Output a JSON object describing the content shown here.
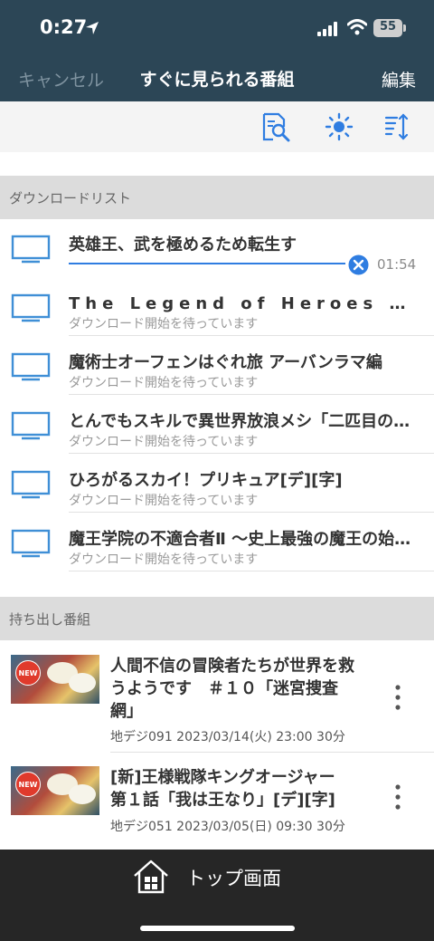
{
  "status_bar": {
    "time": "0:27",
    "battery": "55"
  },
  "nav": {
    "cancel_label": "キャンセル",
    "title": "すぐに見られる番組",
    "edit_label": "編集"
  },
  "toolbar": {
    "icons": [
      "document-search-icon",
      "brightness-icon",
      "sort-icon"
    ]
  },
  "download_section": {
    "header": "ダウンロードリスト",
    "items": [
      {
        "title": "英雄王、武を極めるため転生す",
        "status": "",
        "progress": 1.0,
        "remaining": "01:54"
      },
      {
        "title": "The Legend of Heroes 閃の軌跡 NORTHERN WAR",
        "status": "ダウンロード開始を待っています"
      },
      {
        "title": "魔術士オーフェンはぐれ旅 アーバンラマ編",
        "status": "ダウンロード開始を待っています"
      },
      {
        "title": "とんでもスキルで異世界放浪メシ「二匹目の従魔」",
        "status": "ダウンロード開始を待っています"
      },
      {
        "title": "ひろがるスカイ！プリキュア[デ][字]",
        "status": "ダウンロード開始を待っています"
      },
      {
        "title": "魔王学院の不適合者Ⅱ 〜史上最強の魔王の始祖、転生して子孫たちの学校へ通う〜",
        "status": "ダウンロード開始を待っています"
      }
    ]
  },
  "takeout_section": {
    "header": "持ち出し番組",
    "items": [
      {
        "badge": "NEW",
        "title_line1": "人間不信の冒険者たちが世界を救",
        "title_line2": "うようです　＃１０「迷宮捜査",
        "title_line3": "網」",
        "meta": "地デジ091  2023/03/14(火) 23:00  30分"
      },
      {
        "badge": "NEW",
        "title_line1": "[新]王様戦隊キングオージャー",
        "title_line2": "第１話「我は王なり」[デ][字]",
        "meta": "地デジ051  2023/03/05(日) 09:30  30分"
      }
    ]
  },
  "bottom_bar": {
    "home_label": "トップ画面"
  },
  "colors": {
    "nav_bg": "#2c4656",
    "accent": "#2f7de1",
    "tv_icon": "#3f8fd6",
    "bottom_bg": "#262626"
  }
}
